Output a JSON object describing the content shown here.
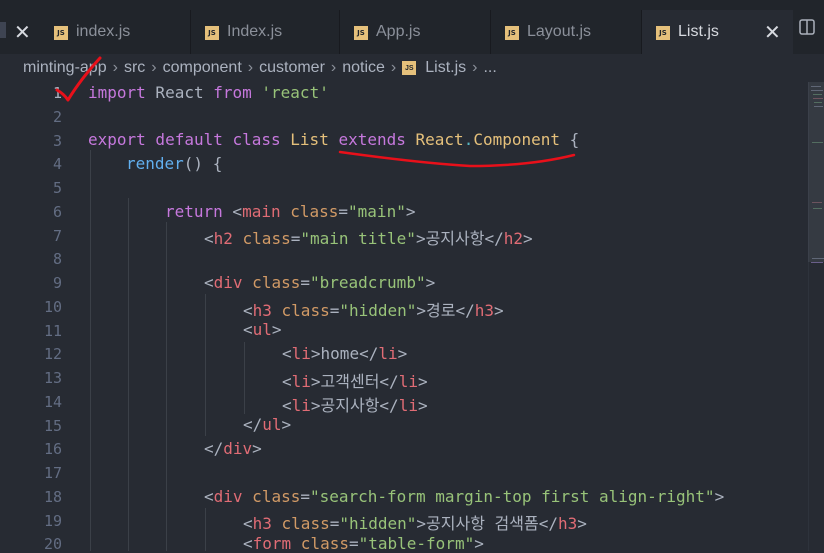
{
  "tabs": [
    {
      "label": "index.js",
      "active": false
    },
    {
      "label": "Index.js",
      "active": false
    },
    {
      "label": "App.js",
      "active": false
    },
    {
      "label": "Layout.js",
      "active": false
    },
    {
      "label": "List.js",
      "active": true
    }
  ],
  "tab_close": "✕",
  "breadcrumb": [
    "minting-app",
    "src",
    "component",
    "customer",
    "notice",
    "List.js",
    "..."
  ],
  "js_badge": "JS",
  "editor": {
    "current_line": 1,
    "lines": [
      {
        "n": "1"
      },
      {
        "n": "2"
      },
      {
        "n": "3"
      },
      {
        "n": "4"
      },
      {
        "n": "5"
      },
      {
        "n": "6"
      },
      {
        "n": "7"
      },
      {
        "n": "8"
      },
      {
        "n": "9"
      },
      {
        "n": "10"
      },
      {
        "n": "11"
      },
      {
        "n": "12"
      },
      {
        "n": "13"
      },
      {
        "n": "14"
      },
      {
        "n": "15"
      },
      {
        "n": "16"
      },
      {
        "n": "17"
      },
      {
        "n": "18"
      },
      {
        "n": "19"
      },
      {
        "n": "20"
      }
    ],
    "code": {
      "l1": {
        "k1": "import",
        "p1": " React ",
        "k2": "from",
        "s1": " 'react'"
      },
      "l3": {
        "k1": "export",
        "k2": " default",
        "k3": " class",
        "c1": " List",
        "k4": " extends",
        "c2": " React",
        "d": ".",
        "c3": "Component",
        "p1": " {"
      },
      "l4": {
        "f": "render",
        "p1": "() {"
      },
      "l6": {
        "k1": "return",
        "p1": " <",
        "t1": "main",
        "a1": " class",
        "p2": "=",
        "s1": "\"main\"",
        "p3": ">"
      },
      "l7": {
        "p1": "<",
        "t1": "h2",
        "a1": " class",
        "p2": "=",
        "s1": "\"main title\"",
        "p3": ">공지사항</",
        "t2": "h2",
        "p4": ">"
      },
      "l9": {
        "p1": "<",
        "t1": "div",
        "a1": " class",
        "p2": "=",
        "s1": "\"breadcrumb\"",
        "p3": ">"
      },
      "l10": {
        "p1": "<",
        "t1": "h3",
        "a1": " class",
        "p2": "=",
        "s1": "\"hidden\"",
        "p3": ">경로</",
        "t2": "h3",
        "p4": ">"
      },
      "l11": {
        "p1": "<",
        "t1": "ul",
        "p2": ">"
      },
      "l12": {
        "p1": "<",
        "t1": "li",
        "p2": ">home</",
        "t2": "li",
        "p3": ">"
      },
      "l13": {
        "p1": "<",
        "t1": "li",
        "p2": ">고객센터</",
        "t2": "li",
        "p3": ">"
      },
      "l14": {
        "p1": "<",
        "t1": "li",
        "p2": ">공지사항</",
        "t2": "li",
        "p3": ">"
      },
      "l15": {
        "p1": "</",
        "t1": "ul",
        "p2": ">"
      },
      "l16": {
        "p1": "</",
        "t1": "div",
        "p2": ">"
      },
      "l18": {
        "p1": "<",
        "t1": "div",
        "a1": " class",
        "p2": "=",
        "s1": "\"search-form margin-top first align-right\"",
        "p3": ">"
      },
      "l19": {
        "p1": "<",
        "t1": "h3",
        "a1": " class",
        "p2": "=",
        "s1": "\"hidden\"",
        "p3": ">공지사항 검색폼</",
        "t2": "h3",
        "p4": ">"
      },
      "l20": {
        "p1": "<",
        "t1": "form",
        "a1": " class",
        "p2": "=",
        "s1": "\"table-form\"",
        "p3": ">"
      }
    }
  },
  "colors": {
    "background": "#272b33",
    "tabbar": "#21252b",
    "annotation": "#e8101a",
    "keyword": "#c678dd",
    "class": "#e5c07b",
    "string": "#98c379",
    "tag": "#e06c75",
    "attribute": "#d19a66",
    "function": "#61afef"
  },
  "icons": [
    "js-file-icon",
    "close-icon",
    "split-editor-icon",
    "chevron-right-icon",
    "check-mark-annotation",
    "underline-annotation"
  ]
}
